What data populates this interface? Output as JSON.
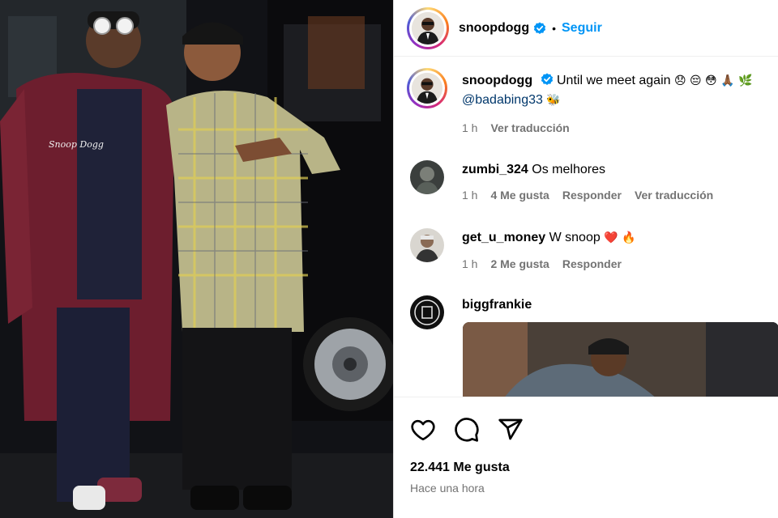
{
  "post": {
    "username": "snoopdogg",
    "follow_label": "Seguir",
    "separator": "•"
  },
  "caption": {
    "username": "snoopdogg",
    "text": "Until we meet again",
    "emojis": "😞 😔 😳 🙏🏾 🌿",
    "mention": "@badabing33",
    "mention_emoji": "🐝",
    "time": "1 h",
    "translate": "Ver traducción"
  },
  "comments": [
    {
      "username": "zumbi_324",
      "text": "Os melhores",
      "time": "1 h",
      "likes": "4 Me gusta",
      "reply": "Responder",
      "translate": "Ver traducción"
    },
    {
      "username": "get_u_money",
      "text": "W snoop",
      "emojis": "❤️ 🔥",
      "time": "1 h",
      "likes": "2 Me gusta",
      "reply": "Responder"
    },
    {
      "username": "biggfrankie"
    }
  ],
  "footer": {
    "likes": "22.441 Me gusta",
    "time": "Hace una hora"
  },
  "colors": {
    "accent": "#0095f6",
    "mention": "#00376b",
    "muted": "#737373",
    "like_heart": "#ed4956"
  },
  "icons": [
    "verified-badge-icon",
    "heart-icon",
    "comment-icon",
    "share-icon"
  ]
}
